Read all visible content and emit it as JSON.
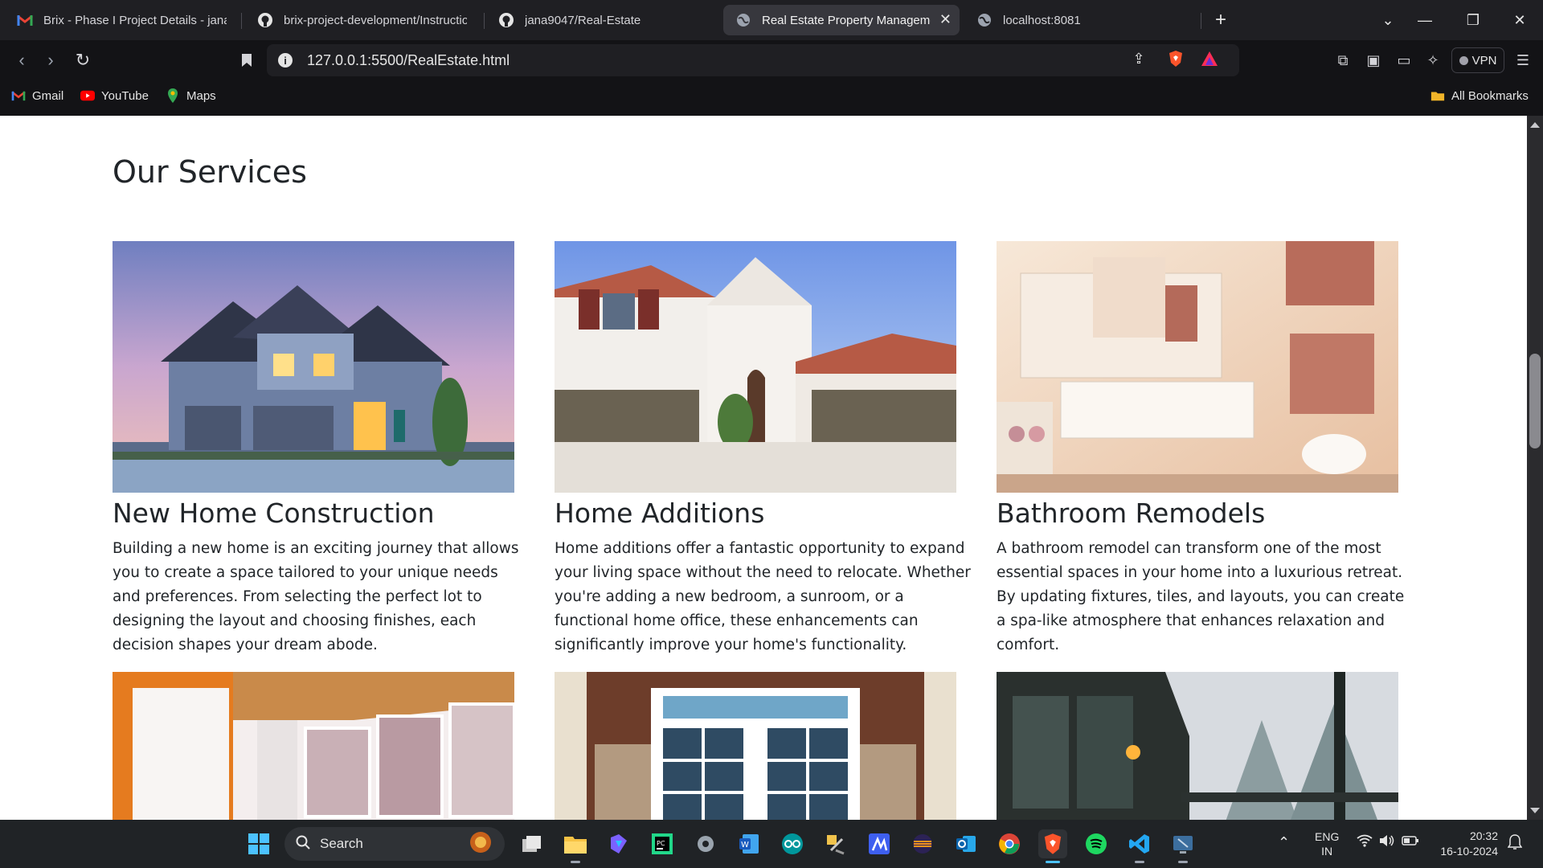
{
  "browser": {
    "tabs": [
      {
        "title": "Brix - Phase I Project Details - janaja",
        "icon": "gmail-icon",
        "active": false
      },
      {
        "title": "brix-project-development/Instructio",
        "icon": "github-icon",
        "active": false
      },
      {
        "title": "jana9047/Real-Estate",
        "icon": "github-icon",
        "active": false
      },
      {
        "title": "Real Estate Property Manageme",
        "icon": "globe-icon",
        "active": true
      },
      {
        "title": "localhost:8081",
        "icon": "globe-icon",
        "active": false
      }
    ],
    "new_tab_label": "+",
    "address": "127.0.0.1:5500/RealEstate.html",
    "vpn_label": "VPN",
    "bookmarks": [
      {
        "label": "Gmail",
        "icon": "gmail-icon"
      },
      {
        "label": "YouTube",
        "icon": "youtube-icon"
      },
      {
        "label": "Maps",
        "icon": "maps-icon"
      }
    ],
    "all_bookmarks_label": "All Bookmarks"
  },
  "page": {
    "heading": "Our Services",
    "services": [
      {
        "title": "New Home Construction",
        "description": "Building a new home is an exciting journey that allows you to create a space tailored to your unique needs and preferences. From selecting the perfect lot to designing the layout and choosing finishes, each decision shapes your dream abode.",
        "image": "two-story-blue-house-photo"
      },
      {
        "title": "Home Additions",
        "description": "Home additions offer a fantastic opportunity to expand your living space without the need to relocate. Whether you're adding a new bedroom, a sunroom, or a functional home office, these enhancements can significantly improve your home's functionality.",
        "image": "white-stucco-house-photo"
      },
      {
        "title": "Bathroom Remodels",
        "description": "A bathroom remodel can transform one of the most essential spaces in your home into a luxurious retreat. By updating fixtures, tiles, and layouts, you can create a spa-like atmosphere that enhances relaxation and comfort.",
        "image": "modern-bathroom-photo"
      }
    ],
    "second_row_images": [
      "sunroom-interior-photo",
      "front-door-windows-photo",
      "snowy-porch-photo"
    ]
  },
  "taskbar": {
    "search_label": "Search",
    "language": "ENG",
    "region": "IN",
    "time": "20:32",
    "date": "16-10-2024"
  },
  "colors": {
    "browser_dark": "#1f1f23",
    "taskbar": "#202326",
    "text": "#212529"
  }
}
